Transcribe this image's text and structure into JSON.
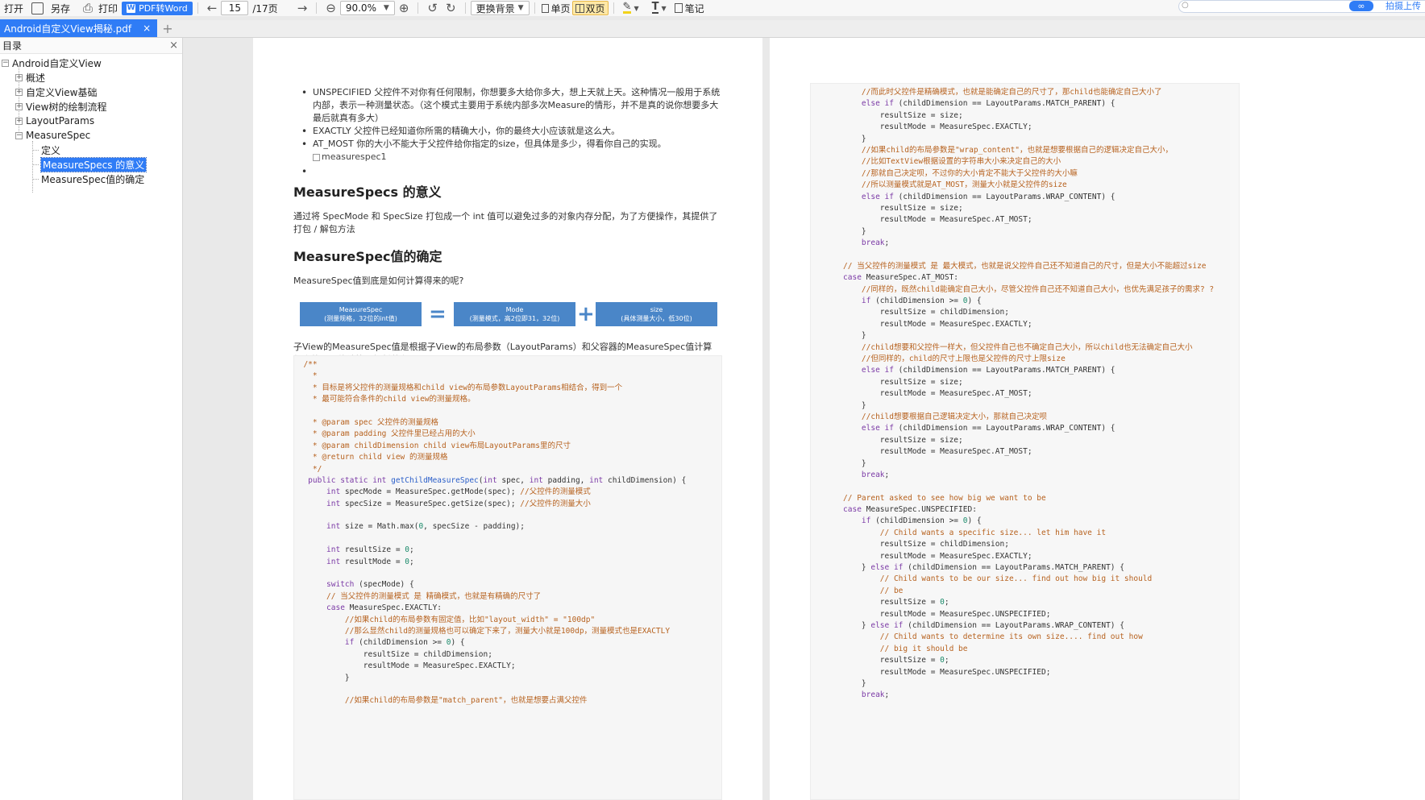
{
  "toolbar": {
    "open": "打开",
    "save_as": "另存",
    "print": "打印",
    "pdf_to_word": "PDF转Word",
    "page_current": "15",
    "page_total": "/17页",
    "zoom": "90.0%",
    "background": "更换背景",
    "single_page": "单页",
    "double_page": "双页",
    "notes": "笔记",
    "upload": "拍摄上传",
    "upload_badge": "∞"
  },
  "tabs": [
    {
      "label": "Android自定义View揭秘.pdf",
      "close": "×"
    }
  ],
  "tab_add": "+",
  "sidebar": {
    "title": "目录",
    "close": "×",
    "items": [
      {
        "label": "Android自定义View",
        "toggle": "−"
      },
      {
        "label": "概述",
        "toggle": "+"
      },
      {
        "label": "自定义View基础",
        "toggle": "+"
      },
      {
        "label": "View树的绘制流程",
        "toggle": "+"
      },
      {
        "label": "LayoutParams",
        "toggle": "+"
      },
      {
        "label": "MeasureSpec",
        "toggle": "−"
      },
      {
        "label": "定义"
      },
      {
        "label": "MeasureSpecs 的意义"
      },
      {
        "label": "MeasureSpec值的确定"
      }
    ]
  },
  "page1": {
    "bullets": [
      "UNSPECIFIED 父控件不对你有任何限制，你想要多大给你多大，想上天就上天。这种情况一般用于系统内部，表示一种测量状态。（这个模式主要用于系统内部多次Measure的情形，并不是真的说你想要多大最后就真有多大）",
      "EXACTLY 父控件已经知道你所需的精确大小，你的最终大小应该就是这么大。",
      "AT_MOST 你的大小不能大于父控件给你指定的size，但具体是多少，得看你自己的实现。",
      ""
    ],
    "img_alt": "measurespec1",
    "h_meaning": "MeasureSpecs 的意义",
    "p_meaning": "通过将 SpecMode 和 SpecSize 打包成一个 int 值可以避免过多的对象内存分配，为了方便操作，其提供了打包 / 解包方法",
    "h_determine": "MeasureSpec值的确定",
    "p_question": "MeasureSpec值到底是如何计算得来的呢?",
    "formula": {
      "box1_title": "MeasureSpec",
      "box1_sub": "(测量规格，32位的int值)",
      "eq": "=",
      "box2_title": "Mode",
      "box2_sub": "(测量模式，高2位即31，32位)",
      "plus": "+",
      "box3_title": "size",
      "box3_sub": "(具体测量大小，低30位)"
    },
    "p_child": "子View的MeasureSpec值是根据子View的布局参数（LayoutParams）和父容器的MeasureSpec值计算得来的，具体计算逻辑封装在getChildMeasureSpec()里"
  },
  "code1": [
    [
      [
        "cm",
        "  /**"
      ]
    ],
    [
      [
        "cm",
        "    *"
      ]
    ],
    [
      [
        "cm",
        "    * 目标是将父控件的测量规格和child view的布局参数LayoutParams相结合，得到一个"
      ]
    ],
    [
      [
        "cm",
        "    * 最可能符合条件的child view的测量规格。"
      ]
    ],
    [
      [
        "ct",
        ""
      ]
    ],
    [
      [
        "cm",
        "    * @param spec 父控件的测量规格"
      ]
    ],
    [
      [
        "cm",
        "    * @param padding 父控件里已经占用的大小"
      ]
    ],
    [
      [
        "cm",
        "    * @param childDimension child view布局LayoutParams里的尺寸"
      ]
    ],
    [
      [
        "cm",
        "    * @return child view 的测量规格"
      ]
    ],
    [
      [
        "cm",
        "    */"
      ]
    ],
    [
      [
        "ck",
        "   public static int "
      ],
      [
        "cf",
        "getChildMeasureSpec"
      ],
      [
        "ct",
        "("
      ],
      [
        "ck",
        "int"
      ],
      [
        "ct",
        " spec, "
      ],
      [
        "ck",
        "int"
      ],
      [
        "ct",
        " padding, "
      ],
      [
        "ck",
        "int"
      ],
      [
        "ct",
        " childDimension) {"
      ]
    ],
    [
      [
        "ck",
        "       int"
      ],
      [
        "ct",
        " specMode = MeasureSpec.getMode(spec); "
      ],
      [
        "cm",
        "//父控件的测量模式"
      ]
    ],
    [
      [
        "ck",
        "       int"
      ],
      [
        "ct",
        " specSize = MeasureSpec.getSize(spec); "
      ],
      [
        "cm",
        "//父控件的测量大小"
      ]
    ],
    [
      [
        "ct",
        ""
      ]
    ],
    [
      [
        "ck",
        "       int"
      ],
      [
        "ct",
        " size = Math.max("
      ],
      [
        "cn",
        "0"
      ],
      [
        "ct",
        ", specSize - padding);"
      ]
    ],
    [
      [
        "ct",
        ""
      ]
    ],
    [
      [
        "ck",
        "       int"
      ],
      [
        "ct",
        " resultSize = "
      ],
      [
        "cn",
        "0"
      ],
      [
        "ct",
        ";"
      ]
    ],
    [
      [
        "ck",
        "       int"
      ],
      [
        "ct",
        " resultMode = "
      ],
      [
        "cn",
        "0"
      ],
      [
        "ct",
        ";"
      ]
    ],
    [
      [
        "ct",
        ""
      ]
    ],
    [
      [
        "ck",
        "       switch"
      ],
      [
        "ct",
        " (specMode) {"
      ]
    ],
    [
      [
        "cm",
        "       // 当父控件的测量模式 是 精确模式，也就是有精确的尺寸了"
      ]
    ],
    [
      [
        "ck",
        "       case"
      ],
      [
        "ct",
        " MeasureSpec.EXACTLY:"
      ]
    ],
    [
      [
        "cm",
        "           //如果child的布局参数有固定值，比如\"layout_width\" = \"100dp\""
      ]
    ],
    [
      [
        "cm",
        "           //那么显然child的测量规格也可以确定下来了，测量大小就是100dp，测量模式也是EXACTLY"
      ]
    ],
    [
      [
        "ck",
        "           if"
      ],
      [
        "ct",
        " (childDimension >= "
      ],
      [
        "cn",
        "0"
      ],
      [
        "ct",
        ") {"
      ]
    ],
    [
      [
        "ct",
        "               resultSize = childDimension;"
      ]
    ],
    [
      [
        "ct",
        "               resultMode = MeasureSpec.EXACTLY;"
      ]
    ],
    [
      [
        "ct",
        "           }"
      ]
    ],
    [
      [
        "ct",
        ""
      ]
    ],
    [
      [
        "cm",
        "           //如果child的布局参数是\"match_parent\"，也就是想要占满父控件"
      ]
    ]
  ],
  "code2": [
    [
      [
        "cm",
        "           //而此时父控件是精确模式，也就是能确定自己的尺寸了，那child也能确定自己大小了"
      ]
    ],
    [
      [
        "ck",
        "           else if"
      ],
      [
        "ct",
        " (childDimension == LayoutParams.MATCH_PARENT) {"
      ]
    ],
    [
      [
        "ct",
        "               resultSize = size;"
      ]
    ],
    [
      [
        "ct",
        "               resultMode = MeasureSpec.EXACTLY;"
      ]
    ],
    [
      [
        "ct",
        "           }"
      ]
    ],
    [
      [
        "cm",
        "           //如果child的布局参数是\"wrap_content\"，也就是想要根据自己的逻辑决定自己大小，"
      ]
    ],
    [
      [
        "cm",
        "           //比如TextView根据设置的字符串大小来决定自己的大小"
      ]
    ],
    [
      [
        "cm",
        "           //那就自己决定呗，不过你的大小肯定不能大于父控件的大小嘛"
      ]
    ],
    [
      [
        "cm",
        "           //所以测量模式就是AT_MOST，测量大小就是父控件的size"
      ]
    ],
    [
      [
        "ck",
        "           else if"
      ],
      [
        "ct",
        " (childDimension == LayoutParams.WRAP_CONTENT) {"
      ]
    ],
    [
      [
        "ct",
        "               resultSize = size;"
      ]
    ],
    [
      [
        "ct",
        "               resultMode = MeasureSpec.AT_MOST;"
      ]
    ],
    [
      [
        "ct",
        "           }"
      ]
    ],
    [
      [
        "ck",
        "           break"
      ],
      [
        "ct",
        ";"
      ]
    ],
    [
      [
        "ct",
        ""
      ]
    ],
    [
      [
        "cm",
        "       // 当父控件的测量模式 是 最大模式，也就是说父控件自己还不知道自己的尺寸，但是大小不能超过size"
      ]
    ],
    [
      [
        "ck",
        "       case"
      ],
      [
        "ct",
        " MeasureSpec.AT_MOST:"
      ]
    ],
    [
      [
        "cm",
        "           //同样的，既然child能确定自己大小，尽管父控件自己还不知道自己大小，也优先满足孩子的需求? ?"
      ]
    ],
    [
      [
        "ck",
        "           if"
      ],
      [
        "ct",
        " (childDimension >= "
      ],
      [
        "cn",
        "0"
      ],
      [
        "ct",
        ") {"
      ]
    ],
    [
      [
        "ct",
        "               resultSize = childDimension;"
      ]
    ],
    [
      [
        "ct",
        "               resultMode = MeasureSpec.EXACTLY;"
      ]
    ],
    [
      [
        "ct",
        "           }"
      ]
    ],
    [
      [
        "cm",
        "           //child想要和父控件一样大，但父控件自己也不确定自己大小，所以child也无法确定自己大小"
      ]
    ],
    [
      [
        "cm",
        "           //但同样的，child的尺寸上限也是父控件的尺寸上限size"
      ]
    ],
    [
      [
        "ck",
        "           else if"
      ],
      [
        "ct",
        " (childDimension == LayoutParams.MATCH_PARENT) {"
      ]
    ],
    [
      [
        "ct",
        "               resultSize = size;"
      ]
    ],
    [
      [
        "ct",
        "               resultMode = MeasureSpec.AT_MOST;"
      ]
    ],
    [
      [
        "ct",
        "           }"
      ]
    ],
    [
      [
        "cm",
        "           //child想要根据自己逻辑决定大小，那就自己决定呗"
      ]
    ],
    [
      [
        "ck",
        "           else if"
      ],
      [
        "ct",
        " (childDimension == LayoutParams.WRAP_CONTENT) {"
      ]
    ],
    [
      [
        "ct",
        "               resultSize = size;"
      ]
    ],
    [
      [
        "ct",
        "               resultMode = MeasureSpec.AT_MOST;"
      ]
    ],
    [
      [
        "ct",
        "           }"
      ]
    ],
    [
      [
        "ck",
        "           break"
      ],
      [
        "ct",
        ";"
      ]
    ],
    [
      [
        "ct",
        ""
      ]
    ],
    [
      [
        "cm",
        "       // Parent asked to see how big we want to be"
      ]
    ],
    [
      [
        "ck",
        "       case"
      ],
      [
        "ct",
        " MeasureSpec.UNSPECIFIED:"
      ]
    ],
    [
      [
        "ck",
        "           if"
      ],
      [
        "ct",
        " (childDimension >= "
      ],
      [
        "cn",
        "0"
      ],
      [
        "ct",
        ") {"
      ]
    ],
    [
      [
        "cm",
        "               // Child wants a specific size... let him have it"
      ]
    ],
    [
      [
        "ct",
        "               resultSize = childDimension;"
      ]
    ],
    [
      [
        "ct",
        "               resultMode = MeasureSpec.EXACTLY;"
      ]
    ],
    [
      [
        "ct",
        "           } "
      ],
      [
        "ck",
        "else if"
      ],
      [
        "ct",
        " (childDimension == LayoutParams.MATCH_PARENT) {"
      ]
    ],
    [
      [
        "cm",
        "               // Child wants to be our size... find out how big it should"
      ]
    ],
    [
      [
        "cm",
        "               // be"
      ]
    ],
    [
      [
        "ct",
        "               resultSize = "
      ],
      [
        "cn",
        "0"
      ],
      [
        "ct",
        ";"
      ]
    ],
    [
      [
        "ct",
        "               resultMode = MeasureSpec.UNSPECIFIED;"
      ]
    ],
    [
      [
        "ct",
        "           } "
      ],
      [
        "ck",
        "else if"
      ],
      [
        "ct",
        " (childDimension == LayoutParams.WRAP_CONTENT) {"
      ]
    ],
    [
      [
        "cm",
        "               // Child wants to determine its own size.... find out how"
      ]
    ],
    [
      [
        "cm",
        "               // big it should be"
      ]
    ],
    [
      [
        "ct",
        "               resultSize = "
      ],
      [
        "cn",
        "0"
      ],
      [
        "ct",
        ";"
      ]
    ],
    [
      [
        "ct",
        "               resultMode = MeasureSpec.UNSPECIFIED;"
      ]
    ],
    [
      [
        "ct",
        "           }"
      ]
    ],
    [
      [
        "ck",
        "           break"
      ],
      [
        "ct",
        ";"
      ]
    ]
  ]
}
